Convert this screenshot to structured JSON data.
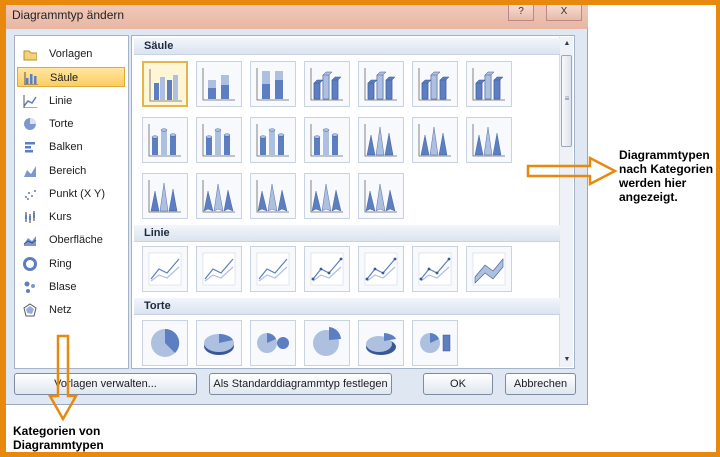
{
  "window": {
    "title": "Diagrammtyp ändern",
    "help_glyph": "?",
    "close_glyph": "X"
  },
  "categories": [
    {
      "label": "Vorlagen",
      "icon": "folder-icon",
      "selected": false
    },
    {
      "label": "Säule",
      "icon": "column-chart-icon",
      "selected": true
    },
    {
      "label": "Linie",
      "icon": "line-chart-icon",
      "selected": false
    },
    {
      "label": "Torte",
      "icon": "pie-chart-icon",
      "selected": false
    },
    {
      "label": "Balken",
      "icon": "bar-chart-icon",
      "selected": false
    },
    {
      "label": "Bereich",
      "icon": "area-chart-icon",
      "selected": false
    },
    {
      "label": "Punkt (X Y)",
      "icon": "scatter-chart-icon",
      "selected": false
    },
    {
      "label": "Kurs",
      "icon": "stock-chart-icon",
      "selected": false
    },
    {
      "label": "Oberfläche",
      "icon": "surface-chart-icon",
      "selected": false
    },
    {
      "label": "Ring",
      "icon": "doughnut-chart-icon",
      "selected": false
    },
    {
      "label": "Blase",
      "icon": "bubble-chart-icon",
      "selected": false
    },
    {
      "label": "Netz",
      "icon": "radar-chart-icon",
      "selected": false
    }
  ],
  "gallery": {
    "sections": [
      {
        "title": "Säule",
        "thumbnail_count": 19,
        "selected_index": 0
      },
      {
        "title": "Linie",
        "thumbnail_count": 7
      },
      {
        "title": "Torte",
        "thumbnail_count": 6
      }
    ]
  },
  "buttons": {
    "templates": "Vorlagen verwalten...",
    "default": "Als Standarddiagrammtyp festlegen",
    "ok": "OK",
    "cancel": "Abbrechen"
  },
  "annotations": {
    "right": "Diagrammtypen nach Kategorien werden hier angezeigt.",
    "bottom": "Kategorien von Diagrammtypen"
  },
  "colors": {
    "border_orange": "#e8890f",
    "selection_yellow": "#fbcd62",
    "chart_blue": "#5b7fc1"
  }
}
